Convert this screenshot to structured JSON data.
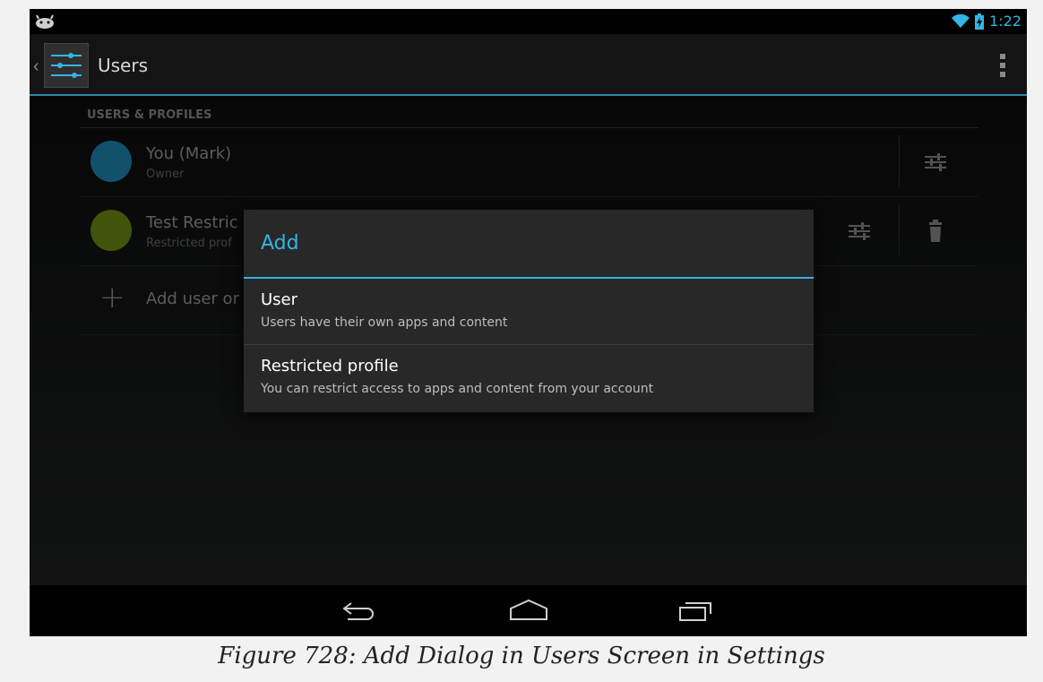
{
  "status": {
    "time": "1:22"
  },
  "action_bar": {
    "title": "Users"
  },
  "section": {
    "header": "USERS & PROFILES"
  },
  "users": [
    {
      "name": "You (Mark)",
      "role": "Owner"
    },
    {
      "name": "Test Restric",
      "role": "Restricted prof"
    }
  ],
  "add_row": {
    "label": "Add user or"
  },
  "dialog": {
    "title": "Add",
    "options": [
      {
        "title": "User",
        "subtitle": "Users have their own apps and content"
      },
      {
        "title": "Restricted profile",
        "subtitle": "You can restrict access to apps and content from your account"
      }
    ]
  },
  "caption": "Figure 728: Add Dialog in Users Screen in Settings",
  "colors": {
    "accent": "#33b5e5",
    "owner_avatar": "#1f88b5",
    "restricted_avatar": "#6f8c13"
  },
  "icons": [
    "android-icon",
    "wifi-icon",
    "battery-icon",
    "settings-app-icon",
    "overflow-menu-icon",
    "profile-settings-icon",
    "delete-icon",
    "add-icon",
    "back-icon",
    "home-icon",
    "recents-icon"
  ]
}
